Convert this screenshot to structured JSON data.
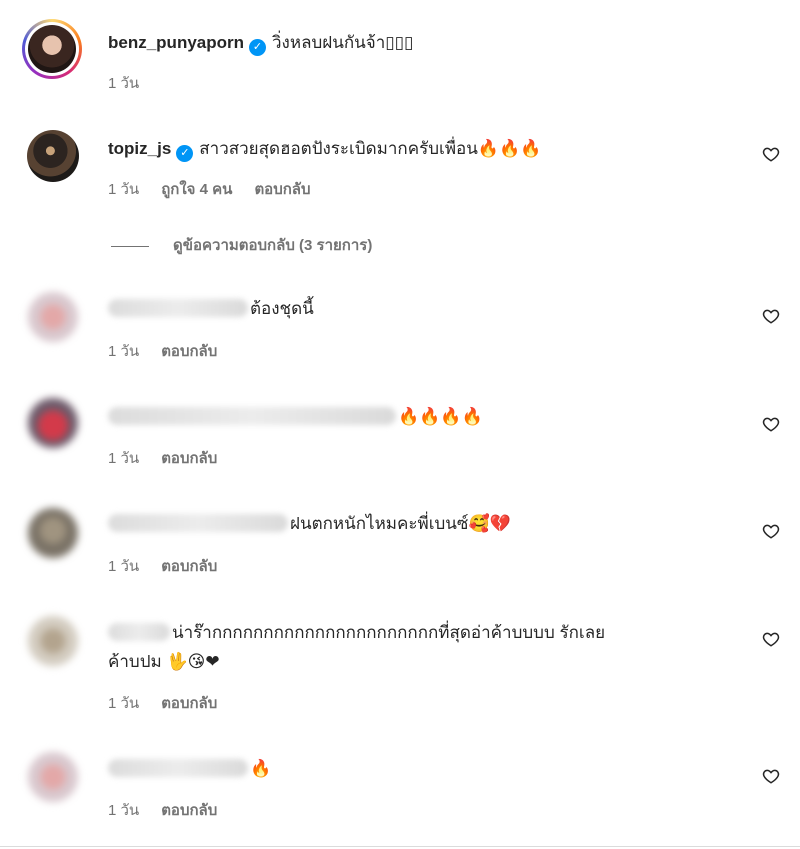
{
  "caption": {
    "username": "benz_punyaporn",
    "text": "วิ่งหลบฝนกันจ้า▯▯▯",
    "time": "1 วัน"
  },
  "comments": [
    {
      "username": "topiz_js",
      "verified": true,
      "text": "สาวสวยสุดฮอตปังระเบิดมากครับเพื่อน",
      "emoji": "🔥🔥🔥",
      "time": "1 วัน",
      "likes": "ถูกใจ 4 คน",
      "reply": "ตอบกลับ"
    },
    {
      "username": "",
      "text": "ต้องชุดนี้",
      "emoji": "",
      "time": "1 วัน",
      "reply": "ตอบกลับ"
    },
    {
      "username": "",
      "text": "",
      "emoji": "🔥🔥🔥🔥",
      "time": "1 วัน",
      "reply": "ตอบกลับ"
    },
    {
      "username": "",
      "text": "ฝนตกหนักไหมคะพี่เบนซ์",
      "emoji": "🥰💔",
      "time": "1 วัน",
      "reply": "ตอบกลับ"
    },
    {
      "username": "",
      "text": "น่าร๊ากกกกกกกกกกกกกกกกกกกกกกที่สุดอ่าค้าบบบบ รักเลย",
      "text2": "ค้าบปม",
      "emoji": "🖖😘❤",
      "time": "1 วัน",
      "reply": "ตอบกลับ"
    },
    {
      "username": "",
      "text": "",
      "emoji": "🔥",
      "time": "1 วัน",
      "reply": "ตอบกลับ"
    }
  ],
  "view_replies": "ดูข้อความตอบกลับ (3 รายการ)",
  "icons": {
    "verified": "verified-badge-icon",
    "like": "heart-outline-icon"
  },
  "colors": {
    "verified": "#0095f6",
    "muted": "#737373",
    "text": "#262626"
  }
}
